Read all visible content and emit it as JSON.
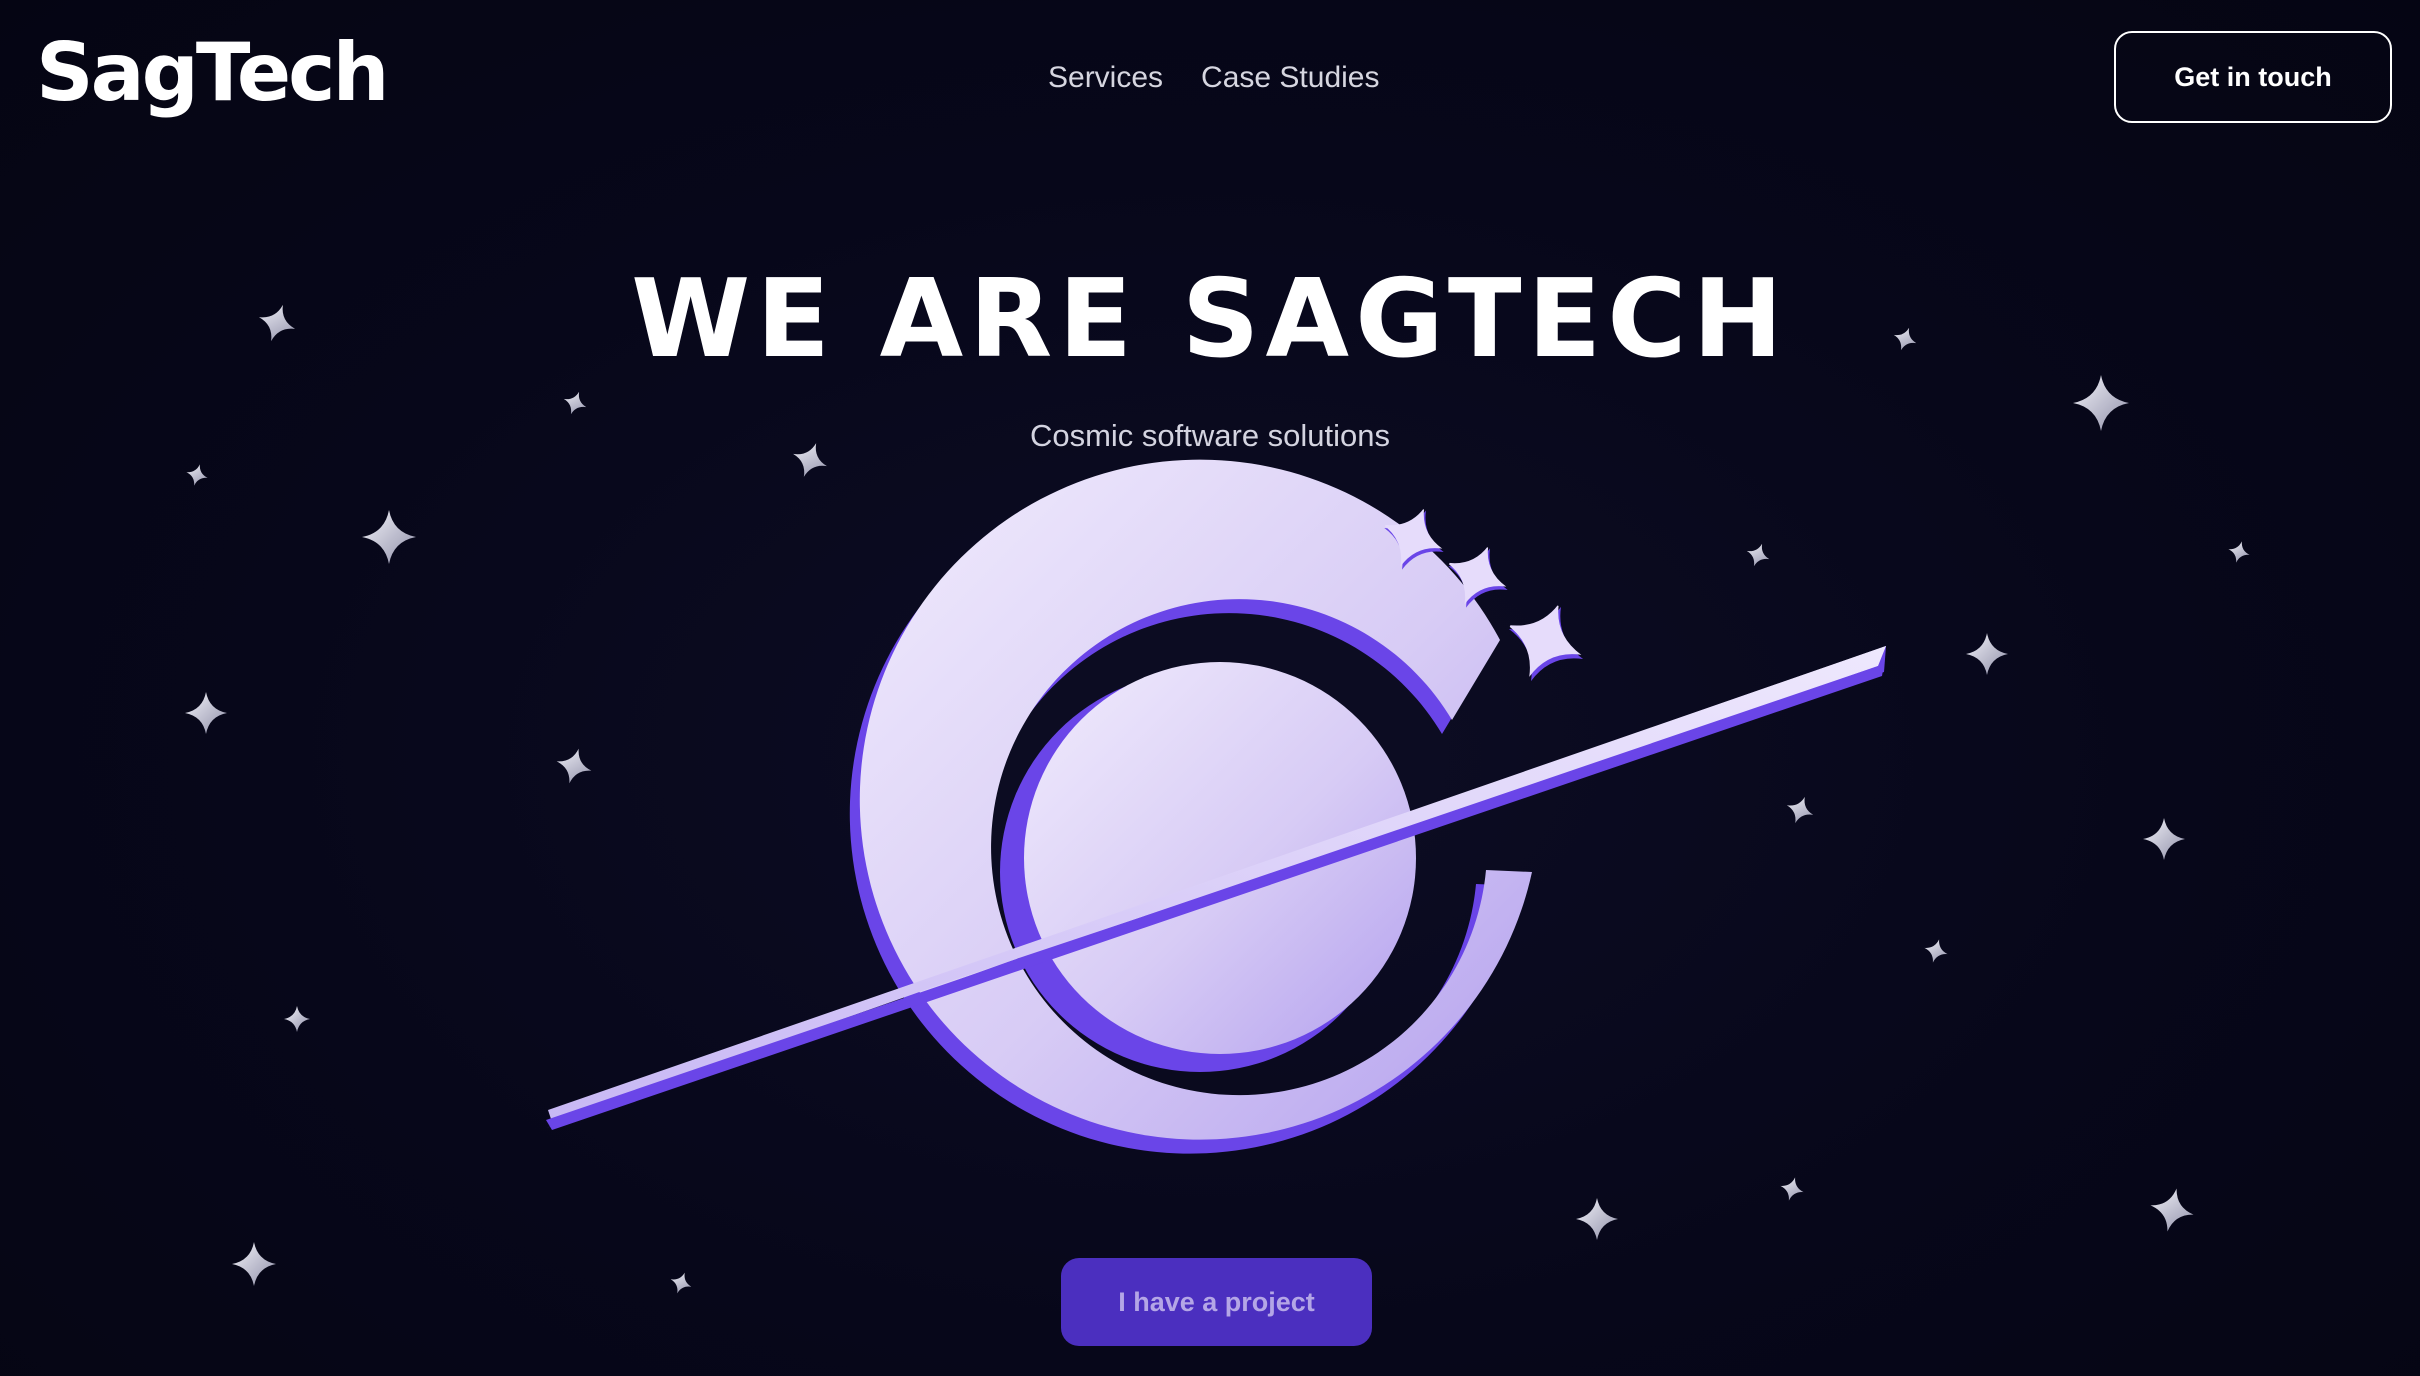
{
  "header": {
    "logo_text": "SagTech",
    "nav": [
      {
        "label": "Services"
      },
      {
        "label": "Case Studies"
      }
    ],
    "cta_label": "Get in touch"
  },
  "hero": {
    "title": "WE ARE SAGTECH",
    "subtitle": "Cosmic software solutions",
    "illustration_icon": "planet-logo-icon",
    "background_icon": "star-icon",
    "cta_label": "I have a project"
  },
  "colors": {
    "background": "#060616",
    "accent_purple": "#6a45e8",
    "planet_light": "#ddd3f7",
    "cta_fill": "#4b2fbf",
    "text_muted": "#d6d6e0"
  }
}
